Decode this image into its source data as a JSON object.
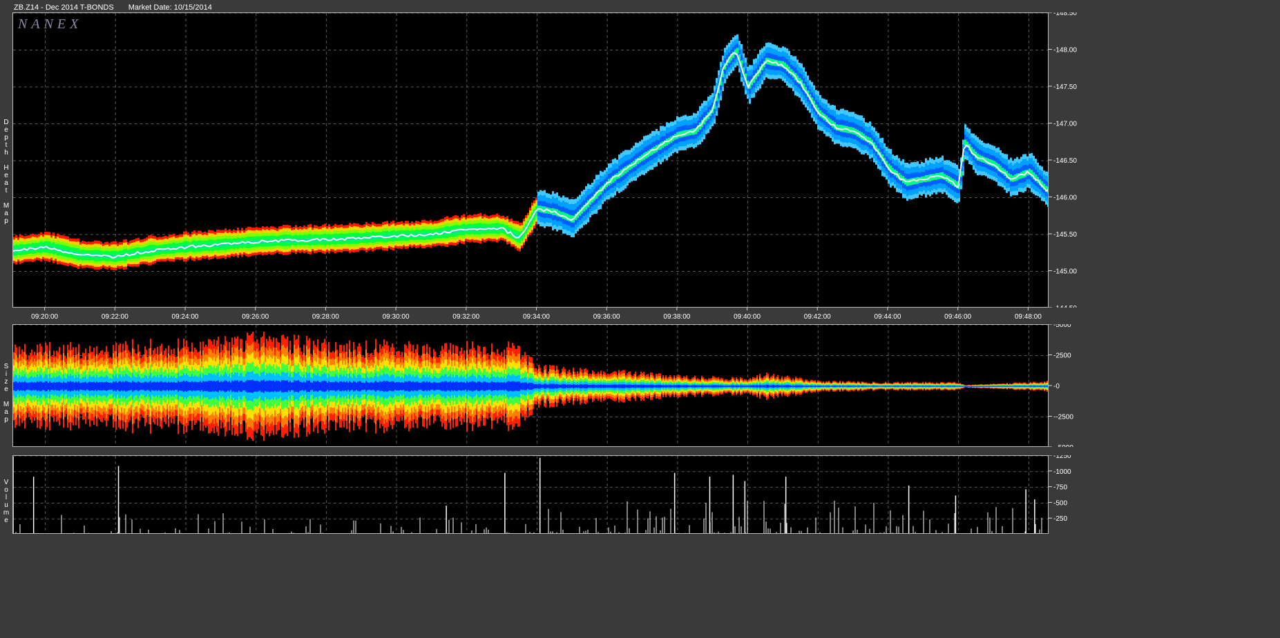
{
  "header": {
    "symbol": "ZB.Z14 - Dec 2014 T-BONDS",
    "market_date": "Market Date: 10/15/2014"
  },
  "brand": "NANEX",
  "panel_labels": {
    "depth": "Depth Heat Map",
    "size": "Size Map",
    "volume": "Volume"
  },
  "colors": {
    "background": "#3a3a3a",
    "panel_bg": "#000000",
    "grid": "#5a5a5a",
    "price_line": "#ffffff",
    "heat_low": "#ff2000",
    "heat_mid": "#00ff40",
    "heat_high": "#0050ff"
  },
  "chart_data": [
    {
      "type": "heatmap",
      "ylim": [
        144.5,
        148.5
      ],
      "y_ticks": [
        "148.50",
        "148.00",
        "147.50",
        "147.00",
        "146.50",
        "146.00",
        "145.50",
        "145.00",
        "144.50"
      ],
      "x_ticks": [
        "09:20:00",
        "09:22:00",
        "09:24:00",
        "09:26:00",
        "09:28:00",
        "09:30:00",
        "09:32:00",
        "09:34:00",
        "09:36:00",
        "09:38:00",
        "09:40:00",
        "09:42:00",
        "09:44:00",
        "09:46:00",
        "09:48:00"
      ],
      "series": [
        {
          "x": [
            "09:19:05",
            "09:20:00",
            "09:21:00",
            "09:22:00",
            "09:23:00",
            "09:24:00",
            "09:25:00",
            "09:26:00",
            "09:27:00",
            "09:28:00",
            "09:29:00",
            "09:30:00",
            "09:31:00",
            "09:32:00",
            "09:33:00",
            "09:33:30",
            "09:34:00",
            "09:34:30",
            "09:35:00",
            "09:36:00",
            "09:37:00",
            "09:38:00",
            "09:38:30",
            "09:39:00",
            "09:39:20",
            "09:39:40",
            "09:40:00",
            "09:40:30",
            "09:41:00",
            "09:41:30",
            "09:42:00",
            "09:42:30",
            "09:43:00",
            "09:43:30",
            "09:44:00",
            "09:44:30",
            "09:45:00",
            "09:45:30",
            "09:46:00",
            "09:46:10",
            "09:46:30",
            "09:47:00",
            "09:47:30",
            "09:48:00",
            "09:48:30"
          ],
          "values": [
            145.28,
            145.33,
            145.22,
            145.2,
            145.28,
            145.33,
            145.36,
            145.4,
            145.42,
            145.43,
            145.45,
            145.48,
            145.5,
            145.57,
            145.58,
            145.45,
            145.85,
            145.8,
            145.7,
            146.2,
            146.55,
            146.85,
            146.9,
            147.2,
            147.8,
            148.0,
            147.5,
            147.85,
            147.8,
            147.55,
            147.15,
            146.95,
            146.9,
            146.75,
            146.4,
            146.2,
            146.25,
            146.3,
            146.15,
            146.75,
            146.55,
            146.45,
            146.25,
            146.35,
            146.1
          ]
        }
      ]
    },
    {
      "type": "area",
      "ylim": [
        -5000,
        5000
      ],
      "y_ticks": [
        "5000",
        "2500",
        "0",
        "-2500",
        "-5000"
      ],
      "series": [
        {
          "x": [
            "09:19:05",
            "09:21:00",
            "09:23:00",
            "09:25:00",
            "09:26:00",
            "09:28:00",
            "09:30:00",
            "09:32:00",
            "09:33:30",
            "09:34:00",
            "09:36:00",
            "09:38:00",
            "09:39:00",
            "09:40:00",
            "09:40:30",
            "09:42:00",
            "09:44:00",
            "09:46:00",
            "09:46:10",
            "09:48:00",
            "09:48:30"
          ],
          "values": [
            3100,
            3000,
            3300,
            3400,
            3800,
            3300,
            3200,
            3100,
            3100,
            1500,
            1200,
            800,
            700,
            600,
            1000,
            400,
            300,
            300,
            100,
            300,
            400
          ]
        }
      ]
    },
    {
      "type": "bar",
      "ylim": [
        0,
        1250
      ],
      "y_ticks": [
        "1250",
        "1000",
        "750",
        "500",
        "250"
      ],
      "series": [
        {
          "x": [
            "09:19:05",
            "09:19:40",
            "09:22:05",
            "09:31:25",
            "09:33:05",
            "09:34:05",
            "09:37:55",
            "09:38:55",
            "09:39:35",
            "09:39:55",
            "09:41:05",
            "09:44:35",
            "09:45:55",
            "09:47:55",
            "09:48:10"
          ],
          "values": [
            1240,
            920,
            1090,
            460,
            980,
            1220,
            980,
            920,
            950,
            850,
            920,
            780,
            620,
            720,
            560
          ]
        }
      ]
    }
  ]
}
